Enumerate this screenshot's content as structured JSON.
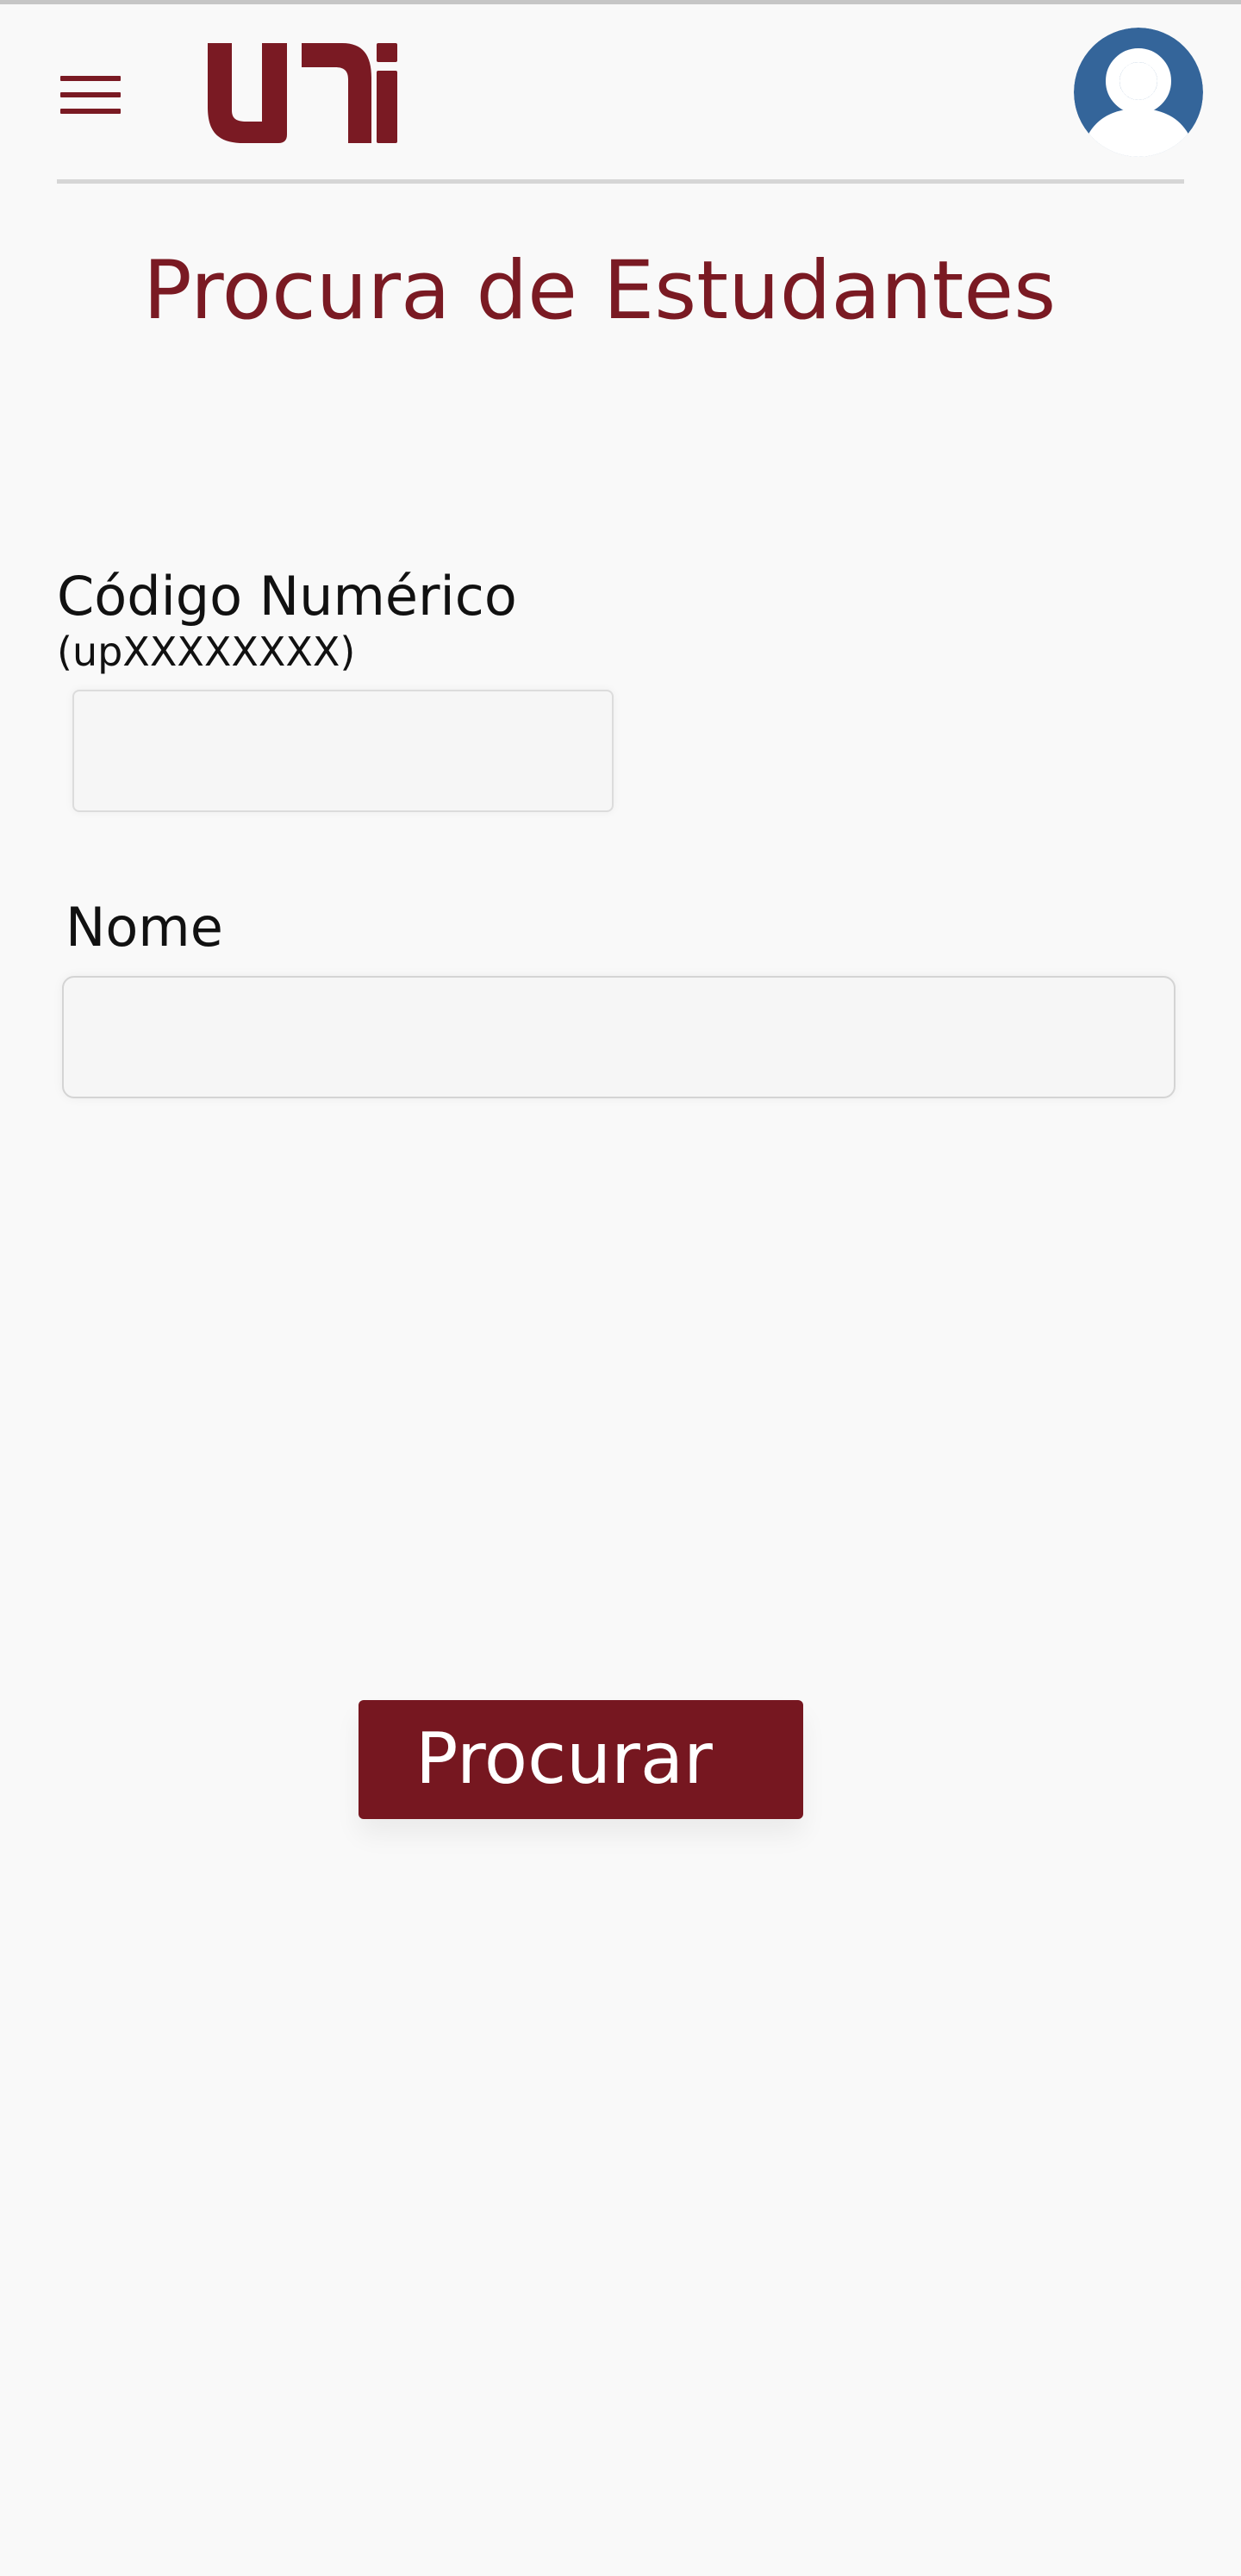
{
  "header": {
    "menu_icon": "hamburger-menu-icon",
    "logo_text": "uni",
    "avatar_icon": "user-avatar-icon"
  },
  "colors": {
    "brand": "#761720",
    "avatar_bg": "#34659a",
    "background": "#f9f9f9"
  },
  "page": {
    "title": "Procura de Estudantes"
  },
  "form": {
    "code_label": "Código Numérico",
    "code_hint": "(upXXXXXXXX)",
    "code_value": "",
    "name_label": "Nome",
    "name_value": "",
    "submit_label": "Procurar"
  }
}
